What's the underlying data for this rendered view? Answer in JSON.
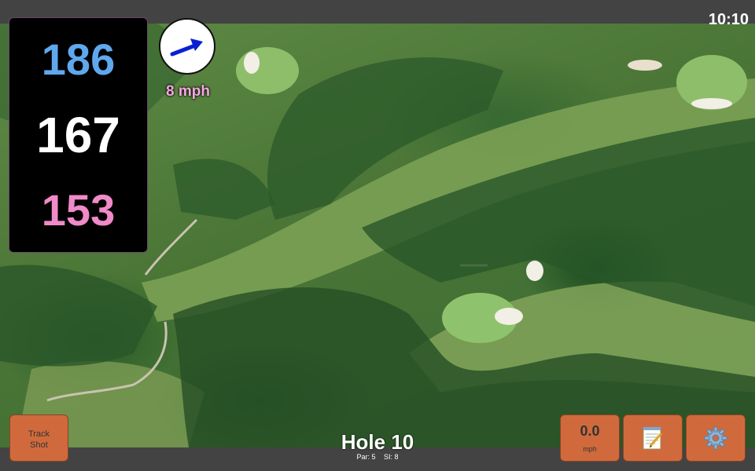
{
  "status": {
    "clock": "10:10"
  },
  "yardage": {
    "back": "186",
    "middle": "167",
    "front": "153"
  },
  "wind": {
    "speed_label": "8 mph",
    "icon": "wind-arrow-icon"
  },
  "buttons": {
    "track_shot_line1": "Track",
    "track_shot_line2": "Shot",
    "speed_value": "0.0",
    "speed_unit": "mph",
    "notes_icon": "notepad-icon",
    "settings_icon": "gear-icon"
  },
  "hole": {
    "title": "Hole 10",
    "par": "Par: 5",
    "si": "SI: 8"
  },
  "colors": {
    "back_yardage": "#5fa8ee",
    "middle_yardage": "#ffffff",
    "front_yardage": "#f08ac8",
    "button_orange": "#d06a3c",
    "wind_label": "#f7a8e0"
  }
}
